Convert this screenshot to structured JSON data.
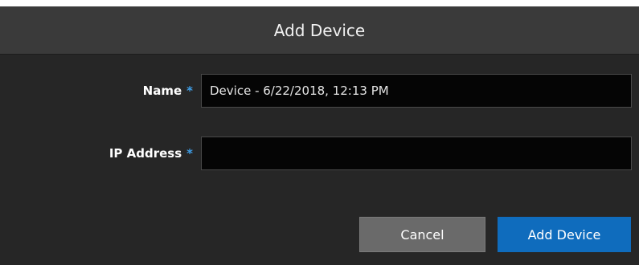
{
  "dialog": {
    "title": "Add Device"
  },
  "form": {
    "name": {
      "label": "Name",
      "required_marker": "*",
      "value": "Device - 6/22/2018, 12:13 PM"
    },
    "ip_address": {
      "label": "IP Address",
      "required_marker": "*",
      "value": ""
    }
  },
  "buttons": {
    "cancel_label": "Cancel",
    "add_label": "Add Device"
  },
  "colors": {
    "dialog_bg": "#262626",
    "header_bg": "#3a3a3a",
    "required_accent": "#3f9fe8",
    "primary_button": "#0f6cbd",
    "secondary_button": "#6a6a6a"
  }
}
